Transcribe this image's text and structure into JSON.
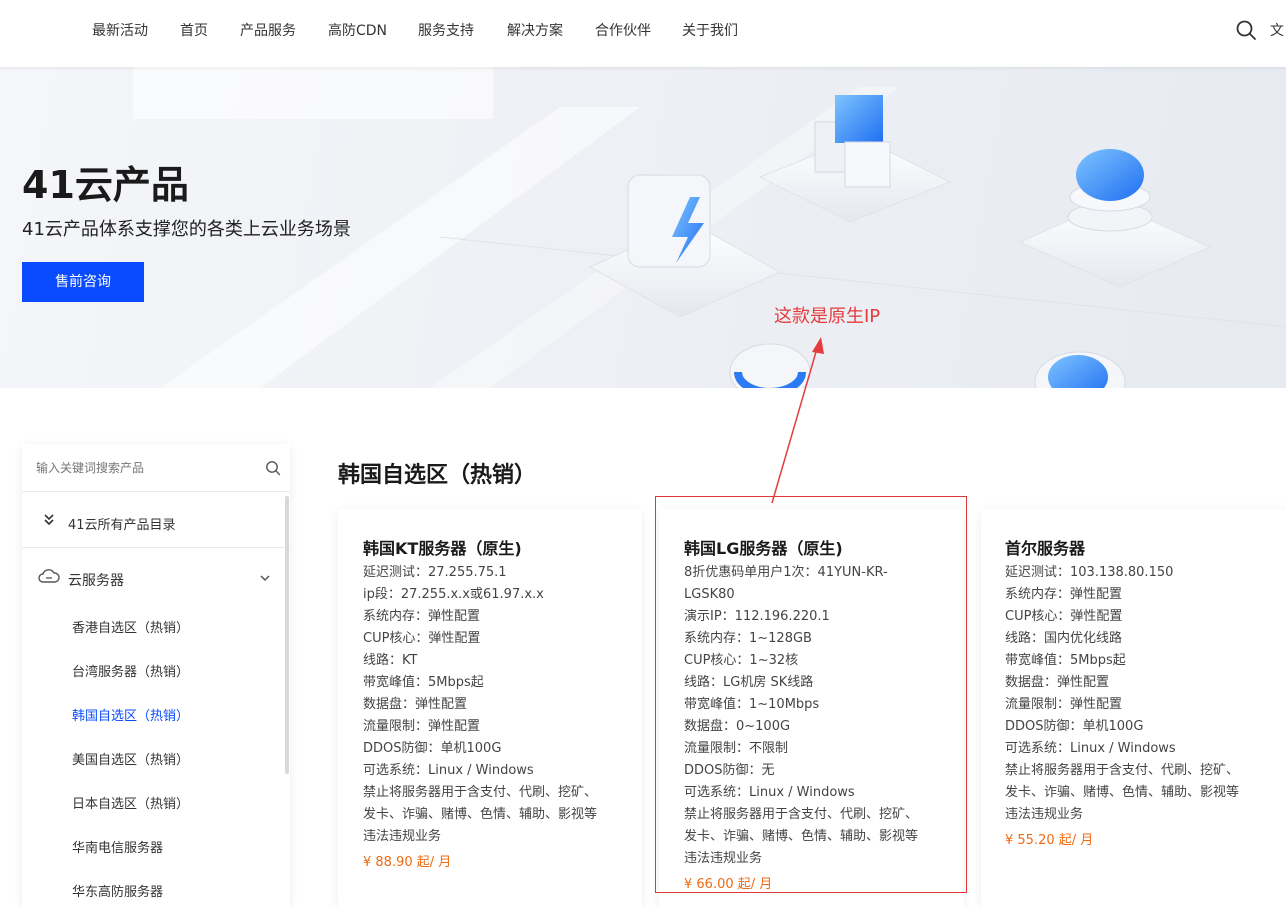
{
  "nav": {
    "items": [
      "最新活动",
      "首页",
      "产品服务",
      "高防CDN",
      "服务支持",
      "解决方案",
      "合作伙伴",
      "关于我们"
    ],
    "lang": "文"
  },
  "hero": {
    "title": "41云产品",
    "subtitle": "41云产品体系支撑您的各类上云业务场景",
    "button": "售前咨询"
  },
  "annotation": {
    "text": "这款是原生IP",
    "color": "#e43c3c"
  },
  "sidebar": {
    "search_placeholder": "输入关键词搜索产品",
    "all_label": "41云所有产品目录",
    "category": "云服务器",
    "items": [
      {
        "label": "香港自选区（热销）",
        "active": false
      },
      {
        "label": "台湾服务器（热销）",
        "active": false
      },
      {
        "label": "韩国自选区（热销）",
        "active": true
      },
      {
        "label": "美国自选区（热销）",
        "active": false
      },
      {
        "label": "日本自选区（热销）",
        "active": false
      },
      {
        "label": "华南电信服务器",
        "active": false
      },
      {
        "label": "华东高防服务器",
        "active": false
      }
    ]
  },
  "section_title": "韩国自选区（热销）",
  "cards": [
    {
      "title": "韩国KT服务器（原生)",
      "lines": [
        "延迟测试：27.255.75.1",
        "ip段：27.255.x.x或61.97.x.x",
        "系统内存：弹性配置",
        "CUP核心：弹性配置",
        "线路：KT",
        "带宽峰值：5Mbps起",
        "数据盘：弹性配置",
        "流量限制：弹性配置",
        "DDOS防御：单机100G",
        "可选系统：Linux / Windows",
        "禁止将服务器用于含支付、代刷、挖矿、",
        "发卡、诈骗、赌博、色情、辅助、影视等",
        "违法违规业务"
      ],
      "price": "¥ 88.90 起/ 月"
    },
    {
      "title": "韩国LG服务器（原生)",
      "lines": [
        "8折优惠码单用户1次：41YUN-KR-",
        "LGSK80",
        "演示IP：112.196.220.1",
        "系统内存：1~128GB",
        "CUP核心：1~32核",
        "线路：LG机房 SK线路",
        "带宽峰值：1~10Mbps",
        "数据盘：0~100G",
        "流量限制：不限制",
        "DDOS防御：无",
        "可选系统：Linux / Windows",
        "禁止将服务器用于含支付、代刷、挖矿、",
        "发卡、诈骗、赌博、色情、辅助、影视等",
        "违法违规业务"
      ],
      "price": "¥ 66.00 起/ 月"
    },
    {
      "title": "首尔服务器",
      "lines": [
        "延迟测试：103.138.80.150",
        "系统内存：弹性配置",
        "CUP核心：弹性配置",
        "线路：国内优化线路",
        "带宽峰值：5Mbps起",
        "数据盘：弹性配置",
        "流量限制：弹性配置",
        "DDOS防御：单机100G",
        "可选系统：Linux / Windows",
        "禁止将服务器用于含支付、代刷、挖矿、",
        "发卡、诈骗、赌博、色情、辅助、影视等",
        "违法违规业务"
      ],
      "price": "¥ 55.20 起/ 月"
    }
  ],
  "colors": {
    "accent": "#0a4bff",
    "price": "#f06a12",
    "highlight": "#e0373a"
  }
}
